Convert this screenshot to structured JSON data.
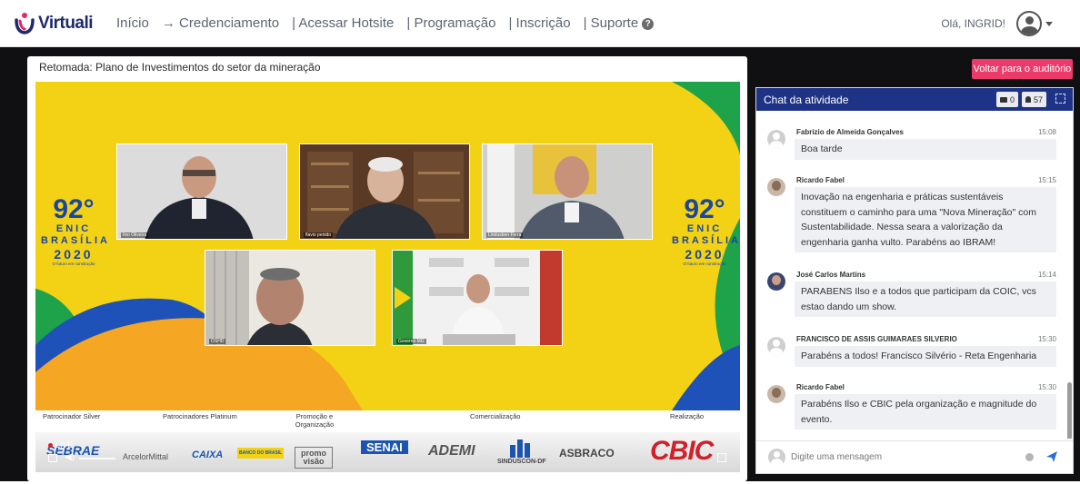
{
  "nav": {
    "brand": "Virtuali",
    "items": [
      "Início",
      "→ Credenciamento",
      "| Acessar Hotsite",
      "| Programação",
      "| Inscrição",
      "| Suporte"
    ],
    "greeting": "Olá, INGRID!"
  },
  "video_card": {
    "title": "Retomada: Plano de Investimentos do setor da mineração"
  },
  "video": {
    "participants": [
      "Ilso Oliveira",
      "flavio penido",
      "Lindusbon Ferra",
      "OSHD",
      "Governo MG"
    ],
    "event_logo": {
      "number": "92°",
      "name": "ENIC",
      "city": "BRASÍLIA",
      "year": "2020",
      "tagline": "O futuro em construção"
    },
    "sponsor_labels": [
      "Patrocinador Silver",
      "Patrocinadores Platinum",
      "Promoção e Organização",
      "Comercialização",
      "Realização"
    ],
    "sponsor_logos": [
      "SEBRAE",
      "ArcelorMittal",
      "CAIXA",
      "BANCO DO BRASIL",
      "promo visão",
      "SENAI",
      "ADEMI",
      "SINDUSCON-DF",
      "ASBRACO",
      "CBIC"
    ],
    "live_label": "LIVE"
  },
  "back_button": "Voltar para o auditório",
  "chat": {
    "title": "Chat da atividade",
    "message_count": "0",
    "participant_count": "57",
    "input_placeholder": "Digite uma mensagem",
    "messages": [
      {
        "name": "Fabrizio de Almeida Gonçalves",
        "time": "15:08",
        "text": "Boa tarde",
        "avatar": "generic"
      },
      {
        "name": "Ricardo Fabel",
        "time": "15:15",
        "text": "Inovação na engenharia e práticas sustentáveis constituem o caminho para uma \"Nova Mineração\" com Sustentabilidade. Nessa seara a valorização da engenharia ganha vulto. Parabéns ao IBRAM!",
        "avatar": "photo"
      },
      {
        "name": "José Carlos Martins",
        "time": "15:14",
        "text": "PARABENS Ilso e a todos que participam da COIC, vcs estao dando um show.",
        "avatar": "photo"
      },
      {
        "name": "FRANCISCO DE ASSIS GUIMARAES SILVERIO",
        "time": "15:30",
        "text": "Parabéns a todos! Francisco Silvério - Reta Engenharia",
        "avatar": "generic"
      },
      {
        "name": "Ricardo Fabel",
        "time": "15:30",
        "text": "Parabéns Ilso e CBIC pela organização e magnitude do evento.",
        "avatar": "photo"
      }
    ]
  },
  "colors": {
    "brand_navy": "#1e3385",
    "accent_pink": "#ec3a6a",
    "video_yellow": "#f3d215",
    "enic_blue": "#1a46a0",
    "cbic_red": "#d0202a"
  }
}
